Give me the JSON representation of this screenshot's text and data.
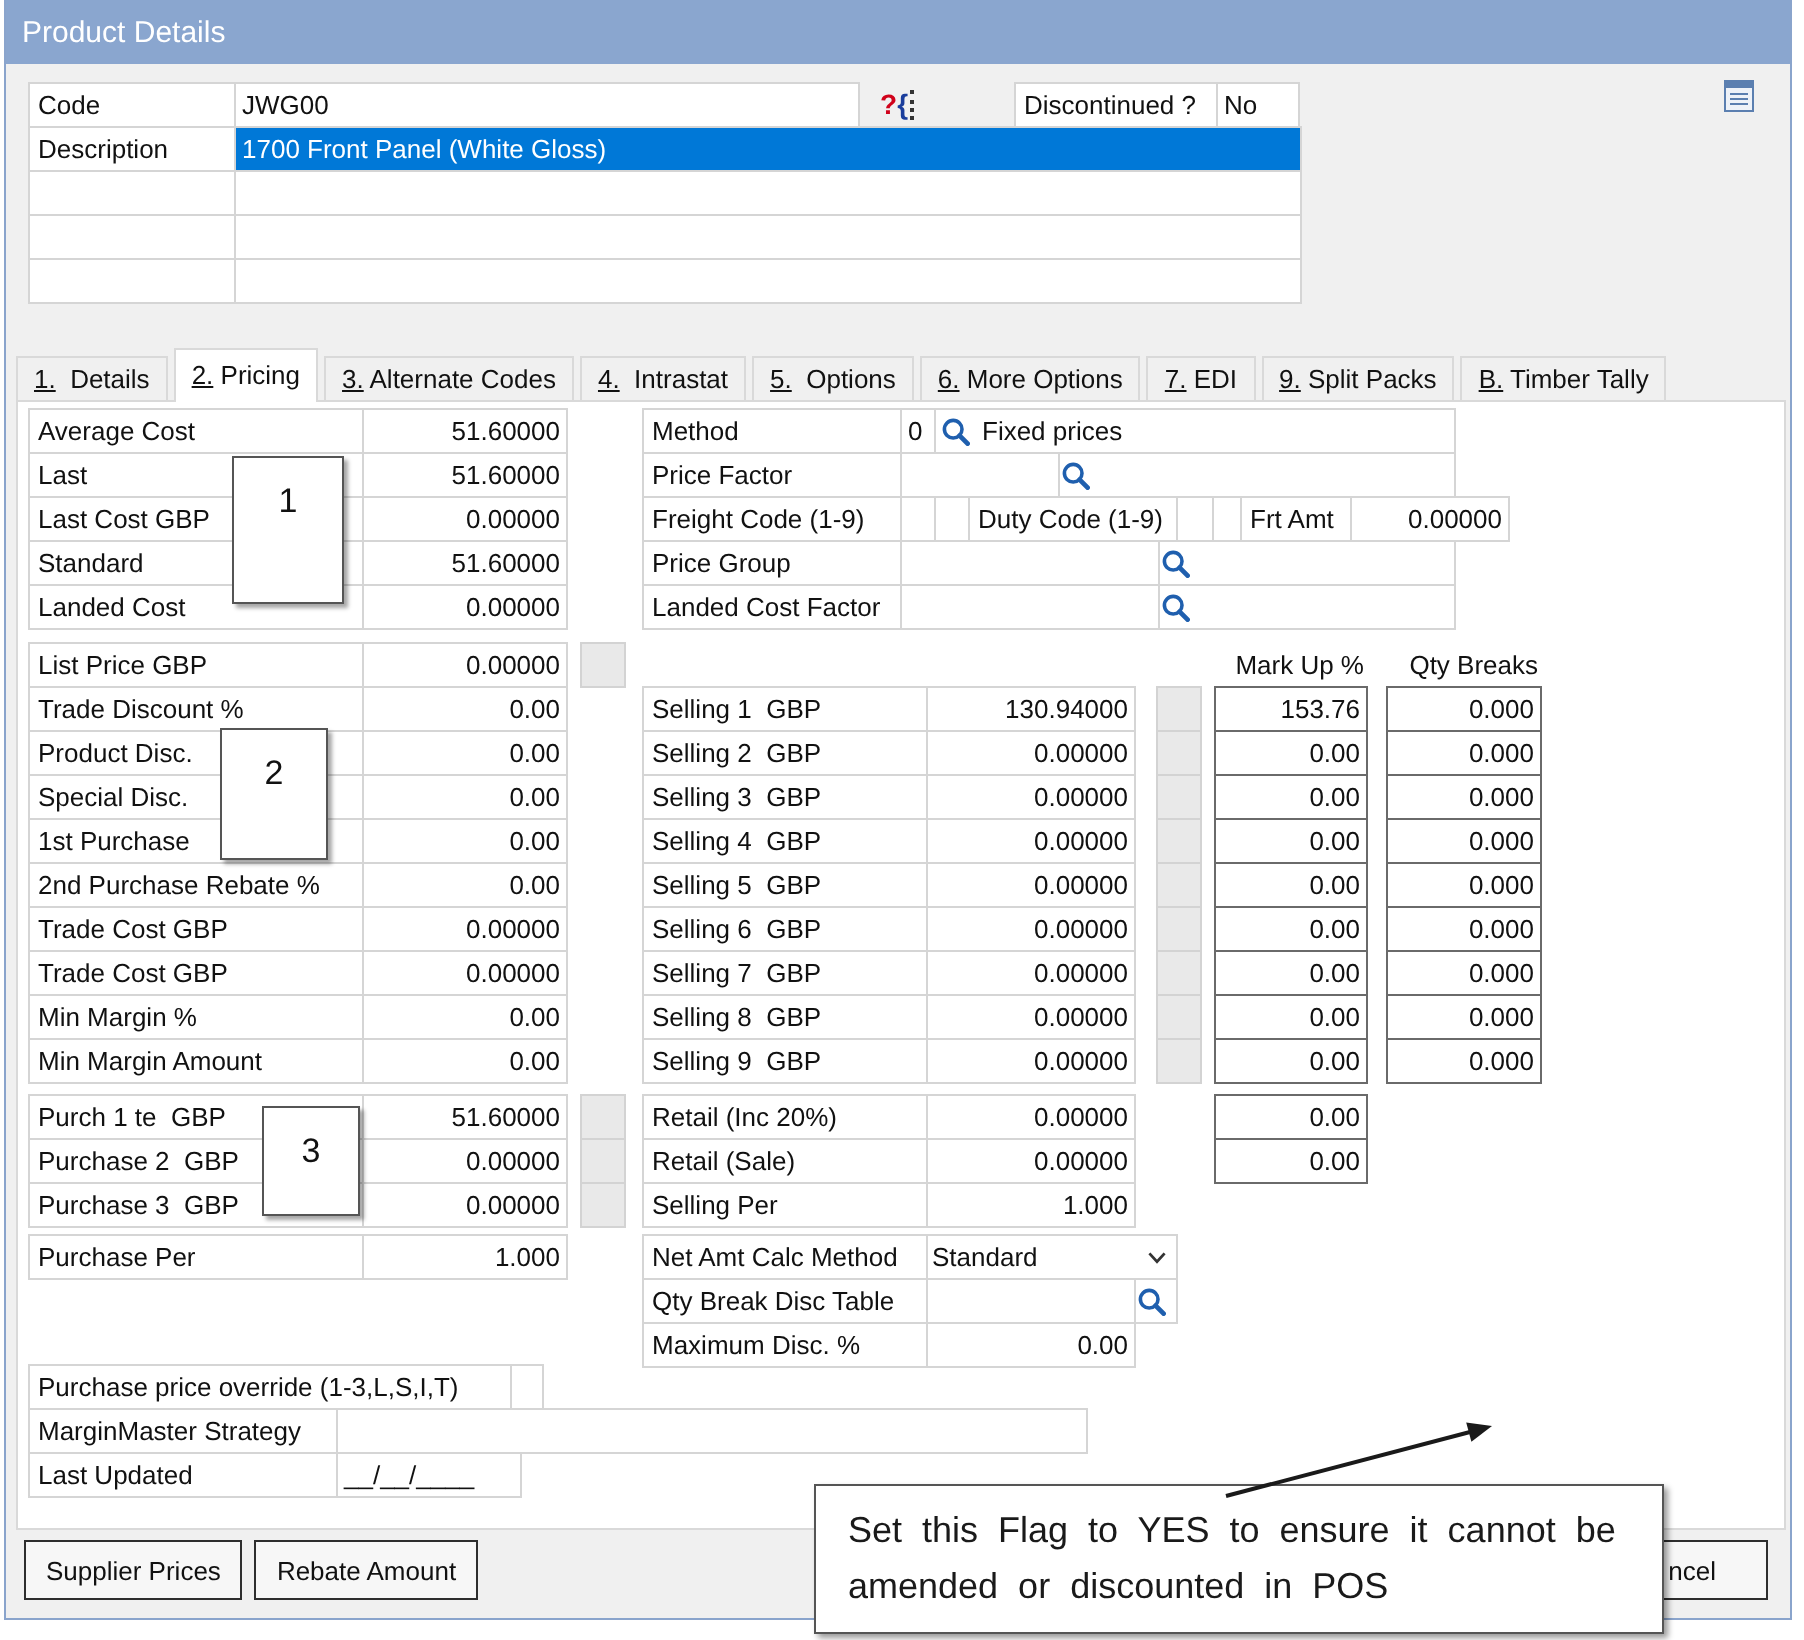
{
  "window": {
    "title": "Product Details"
  },
  "header": {
    "code": {
      "label": "Code",
      "value": "JWG00",
      "marker": "?{"
    },
    "discontinued": {
      "label": "Discontinued ?",
      "value": "No"
    },
    "description": {
      "label": "Description",
      "value": "1700 Front Panel (White Gloss)",
      "selected": true
    }
  },
  "tabs": [
    {
      "label": "1.  Details",
      "selected": false
    },
    {
      "label": "2. Pricing",
      "selected": true
    },
    {
      "label": "3. Alternate Codes",
      "selected": false
    },
    {
      "label": "4.  Intrastat",
      "selected": false
    },
    {
      "label": "5.  Options",
      "selected": false
    },
    {
      "label": "6. More Options",
      "selected": false
    },
    {
      "label": "7. EDI",
      "selected": false
    },
    {
      "label": "9. Split Packs",
      "selected": false
    },
    {
      "label": "B. Timber Tally",
      "selected": false
    }
  ],
  "pricing": {
    "costs": [
      {
        "label": "Average Cost",
        "value": "51.60000"
      },
      {
        "label": "Last",
        "value": "51.60000"
      },
      {
        "label": "Last Cost GBP",
        "value": "0.00000"
      },
      {
        "label": "Standard",
        "value": "51.60000"
      },
      {
        "label": "Landed Cost",
        "value": "0.00000"
      }
    ],
    "prices": [
      {
        "label": "List Price GBP",
        "value": "0.00000"
      },
      {
        "label": "Trade Discount %",
        "value": "0.00"
      },
      {
        "label": "Product Disc.",
        "value": "0.00"
      },
      {
        "label": "Special Disc.",
        "value": "0.00"
      },
      {
        "label": "1st Purchase",
        "value": "0.00"
      },
      {
        "label": "2nd Purchase Rebate %",
        "value": "0.00"
      },
      {
        "label": "Trade Cost GBP",
        "value": "0.00000"
      },
      {
        "label": "Trade Cost GBP",
        "value": "0.00000"
      },
      {
        "label": "Min Margin %",
        "value": "0.00"
      },
      {
        "label": "Min Margin Amount",
        "value": "0.00"
      }
    ],
    "purchase_prices": [
      {
        "label": "Purch 1 te  GBP",
        "value": "51.60000"
      },
      {
        "label": "Purchase 2  GBP",
        "value": "0.00000"
      },
      {
        "label": "Purchase 3  GBP",
        "value": "0.00000"
      }
    ],
    "purchase_per": {
      "label": "Purchase Per",
      "value": "1.000"
    },
    "purchase_price_override": {
      "label": "Purchase price override (1-3,L,S,I,T)"
    },
    "marginmaster_strategy": {
      "label": "MarginMaster Strategy"
    },
    "last_updated": {
      "label": "Last Updated",
      "value": "__/__/____"
    },
    "method": {
      "label": "Method",
      "code": "0",
      "value": "Fixed prices"
    },
    "price_factor": {
      "label": "Price Factor"
    },
    "freight": {
      "label": "Freight Code (1-9)",
      "duty_label": "Duty Code (1-9)",
      "amount_label": "Frt Amt",
      "amount": "0.00000"
    },
    "price_group": {
      "label": "Price Group"
    },
    "landed_cost_factor": {
      "label": "Landed Cost Factor"
    },
    "selling_columns": [
      "Mark Up %",
      "Qty Breaks"
    ],
    "selling_prices": [
      {
        "label": "Selling 1  GBP",
        "value": "130.94000",
        "markup": "153.76",
        "qty_break": "0.000"
      },
      {
        "label": "Selling 2  GBP",
        "value": "0.00000",
        "markup": "0.00",
        "qty_break": "0.000"
      },
      {
        "label": "Selling 3  GBP",
        "value": "0.00000",
        "markup": "0.00",
        "qty_break": "0.000"
      },
      {
        "label": "Selling 4  GBP",
        "value": "0.00000",
        "markup": "0.00",
        "qty_break": "0.000"
      },
      {
        "label": "Selling 5  GBP",
        "value": "0.00000",
        "markup": "0.00",
        "qty_break": "0.000"
      },
      {
        "label": "Selling 6  GBP",
        "value": "0.00000",
        "markup": "0.00",
        "qty_break": "0.000"
      },
      {
        "label": "Selling 7  GBP",
        "value": "0.00000",
        "markup": "0.00",
        "qty_break": "0.000"
      },
      {
        "label": "Selling 8  GBP",
        "value": "0.00000",
        "markup": "0.00",
        "qty_break": "0.000"
      },
      {
        "label": "Selling 9  GBP",
        "value": "0.00000",
        "markup": "0.00",
        "qty_break": "0.000"
      }
    ],
    "retail": [
      {
        "label": "Retail (Inc 20%)",
        "value": "0.00000",
        "markup": "0.00"
      },
      {
        "label": "Retail (Sale)",
        "value": "0.00000",
        "markup": "0.00"
      },
      {
        "label": "Selling Per",
        "value": "1.000"
      }
    ],
    "net_amt_calc_method": {
      "label": "Net Amt Calc Method",
      "value": "Standard"
    },
    "qty_break_disc_table": {
      "label": "Qty Break Disc Table"
    },
    "maximum_disc": {
      "label": "Maximum Disc. %",
      "value": "0.00"
    }
  },
  "buttons": [
    "Supplier Prices",
    "Rebate Amount",
    "ncel"
  ],
  "annotations": {
    "markers": [
      "1",
      "2",
      "3"
    ],
    "callout": "Set this Flag to YES to ensure it cannot be amended or discounted in POS"
  }
}
